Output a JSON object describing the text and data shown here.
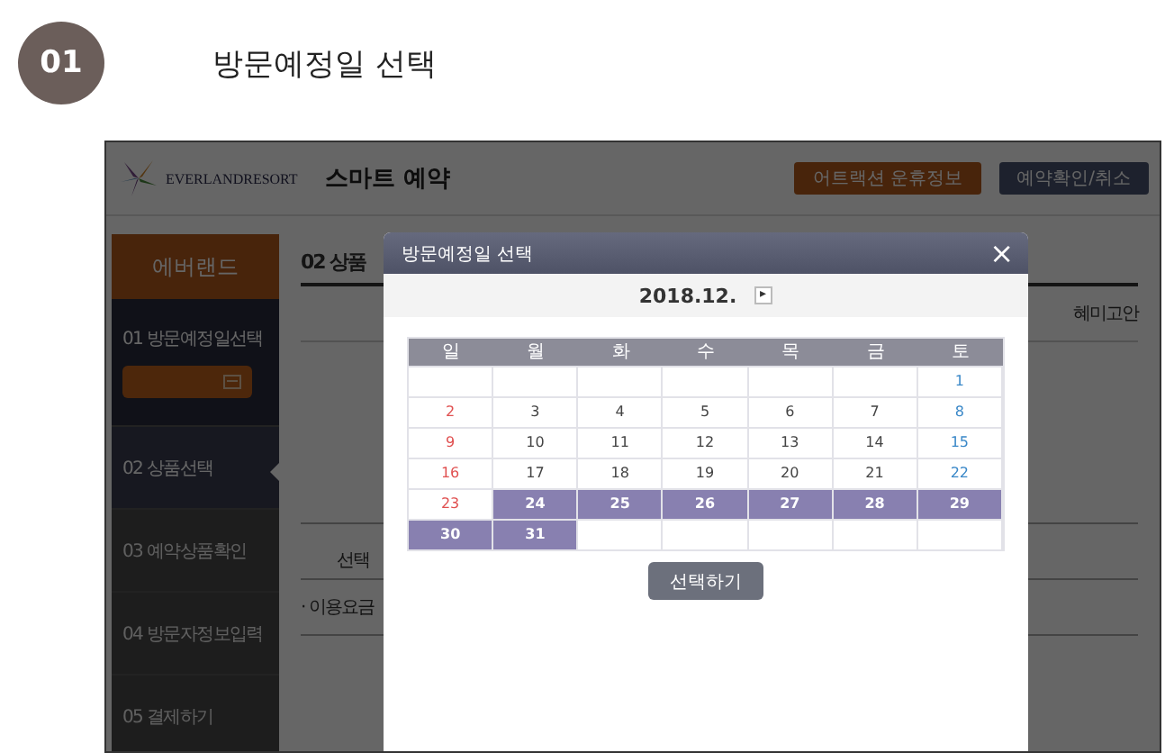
{
  "step": {
    "number": "01",
    "title": "방문예정일 선택"
  },
  "site": {
    "logo_text": "EVERLANDRESORT",
    "title": "스마트 예약",
    "buttons": [
      {
        "label": "어트랙션 운휴정보",
        "kind": "attraction"
      },
      {
        "label": "예약확인/취소",
        "kind": "reservation"
      }
    ]
  },
  "sidebar": {
    "header": "에버랜드",
    "items": [
      {
        "label": "01 방문예정일선택",
        "kind": "date",
        "selected": false
      },
      {
        "label": "02 상품선택",
        "kind": "plain",
        "selected": true
      },
      {
        "label": "03 예약상품확인",
        "kind": "plain",
        "selected": false
      },
      {
        "label": "04 방문자정보입력",
        "kind": "plain",
        "selected": false
      },
      {
        "label": "05 결제하기",
        "kind": "plain",
        "selected": false
      }
    ]
  },
  "main": {
    "heading": "02 상품",
    "column_header": "혜미고안",
    "row_label": "선택",
    "fee_label": "· 이용요금"
  },
  "modal": {
    "title": "방문예정일 선택",
    "close": "×",
    "month": "2018.12.",
    "next": "▸",
    "weekdays": [
      "일",
      "월",
      "화",
      "수",
      "목",
      "금",
      "토"
    ],
    "weeks": [
      [
        {
          "kind": "empty"
        },
        {
          "kind": "empty"
        },
        {
          "kind": "empty"
        },
        {
          "kind": "empty"
        },
        {
          "kind": "empty"
        },
        {
          "kind": "empty"
        },
        {
          "day": "1",
          "kind": "sat",
          "available": false
        }
      ],
      [
        {
          "day": "2",
          "kind": "sun",
          "available": false
        },
        {
          "day": "3",
          "kind": "weekday",
          "available": false
        },
        {
          "day": "4",
          "kind": "weekday",
          "available": false
        },
        {
          "day": "5",
          "kind": "weekday",
          "available": false
        },
        {
          "day": "6",
          "kind": "weekday",
          "available": false
        },
        {
          "day": "7",
          "kind": "weekday",
          "available": false
        },
        {
          "day": "8",
          "kind": "sat",
          "available": false
        }
      ],
      [
        {
          "day": "9",
          "kind": "sun",
          "available": false
        },
        {
          "day": "10",
          "kind": "weekday",
          "available": false
        },
        {
          "day": "11",
          "kind": "weekday",
          "available": false
        },
        {
          "day": "12",
          "kind": "weekday",
          "available": false
        },
        {
          "day": "13",
          "kind": "weekday",
          "available": false
        },
        {
          "day": "14",
          "kind": "weekday",
          "available": false
        },
        {
          "day": "15",
          "kind": "sat",
          "available": false
        }
      ],
      [
        {
          "day": "16",
          "kind": "sun",
          "available": false
        },
        {
          "day": "17",
          "kind": "weekday",
          "available": false
        },
        {
          "day": "18",
          "kind": "weekday",
          "available": false
        },
        {
          "day": "19",
          "kind": "weekday",
          "available": false
        },
        {
          "day": "20",
          "kind": "weekday",
          "available": false
        },
        {
          "day": "21",
          "kind": "weekday",
          "available": false
        },
        {
          "day": "22",
          "kind": "sat",
          "available": false
        }
      ],
      [
        {
          "day": "23",
          "kind": "sun",
          "available": false
        },
        {
          "day": "24",
          "kind": "weekday",
          "available": true
        },
        {
          "day": "25",
          "kind": "weekday",
          "available": true
        },
        {
          "day": "26",
          "kind": "weekday",
          "available": true
        },
        {
          "day": "27",
          "kind": "weekday",
          "available": true
        },
        {
          "day": "28",
          "kind": "weekday",
          "available": true
        },
        {
          "day": "29",
          "kind": "sat",
          "available": true
        }
      ],
      [
        {
          "day": "30",
          "kind": "sun",
          "available": true
        },
        {
          "day": "31",
          "kind": "weekday",
          "available": true
        },
        {
          "kind": "empty"
        },
        {
          "kind": "empty"
        },
        {
          "kind": "empty"
        },
        {
          "kind": "empty"
        },
        {
          "kind": "empty"
        }
      ]
    ],
    "confirm": "선택하기"
  }
}
